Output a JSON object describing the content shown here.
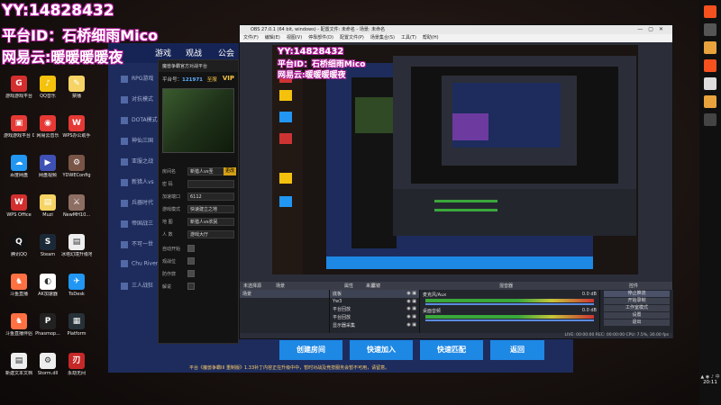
{
  "overlay": {
    "yy": "YY:14828432",
    "platform": "平台ID：石桥细雨Mico",
    "netease": "网易云:暖暖暖暖夜"
  },
  "desktop_icons": [
    {
      "label": "游戏游戏平台",
      "color": "#d32f2f",
      "glyph": "G",
      "icon": "game-platform-icon"
    },
    {
      "label": "QQ音乐",
      "color": "#f4c20d",
      "glyph": "♪",
      "icon": "music-icon"
    },
    {
      "label": "禁播",
      "color": "#f6d365",
      "glyph": "✎",
      "icon": "note-icon"
    },
    {
      "label": "游戏游戏平台 0.7.59",
      "color": "#e53935",
      "glyph": "▣",
      "icon": "file-icon"
    },
    {
      "label": "网易云音乐",
      "color": "#e53935",
      "glyph": "◉",
      "icon": "netease-icon"
    },
    {
      "label": "WPS办公助手",
      "color": "#e53935",
      "glyph": "W",
      "icon": "wps-icon"
    },
    {
      "label": "百度网盘",
      "color": "#2196f3",
      "glyph": "☁",
      "icon": "cloud-icon"
    },
    {
      "label": "网盘视频",
      "color": "#3f51b5",
      "glyph": "▶",
      "icon": "video-icon"
    },
    {
      "label": "YDWEConfig",
      "color": "#795548",
      "glyph": "⚙",
      "icon": "config-icon"
    },
    {
      "label": "WPS Office",
      "color": "#d32f2f",
      "glyph": "W",
      "icon": "wps-office-icon"
    },
    {
      "label": "Muzi",
      "color": "#f6d365",
      "glyph": "▤",
      "icon": "folder-icon"
    },
    {
      "label": "NewMH10...",
      "color": "#8d6e63",
      "glyph": "⚔",
      "icon": "mod-icon"
    },
    {
      "label": "腾讯QQ",
      "color": "#111111",
      "glyph": "Q",
      "icon": "qq-icon"
    },
    {
      "label": "Steam",
      "color": "#1b2838",
      "glyph": "S",
      "icon": "steam-icon"
    },
    {
      "label": "冰塔幻境升级地图脚本",
      "color": "#eeeeee",
      "glyph": "▤",
      "icon": "doc-icon"
    },
    {
      "label": "斗鱼直播",
      "color": "#ff7043",
      "glyph": "♞",
      "icon": "douyu-icon"
    },
    {
      "label": "AK加速器",
      "color": "#ffffff",
      "glyph": "◐",
      "icon": "accel-icon"
    },
    {
      "label": "ToDesk",
      "color": "#2196f3",
      "glyph": "✈",
      "icon": "todesk-icon"
    },
    {
      "label": "斗鱼直播伴侣",
      "color": "#ff7043",
      "glyph": "♞",
      "icon": "douyu-companion-icon"
    },
    {
      "label": "Phasmop...",
      "color": "#222222",
      "glyph": "P",
      "icon": "phasmo-icon"
    },
    {
      "label": "Platform",
      "color": "#263238",
      "glyph": "▦",
      "icon": "platform-icon"
    },
    {
      "label": "新建文本文档",
      "color": "#eeeeee",
      "glyph": "▤",
      "icon": "text-icon"
    },
    {
      "label": "Storm.dll",
      "color": "#eeeeee",
      "glyph": "⚙",
      "icon": "dll-icon"
    },
    {
      "label": "永劫无间",
      "color": "#c62828",
      "glyph": "刃",
      "icon": "naraka-icon"
    }
  ],
  "game": {
    "tabs": [
      "游戏",
      "观战",
      "公会"
    ],
    "side": [
      "RPG游戏",
      "对抗模式",
      "DOTA模式",
      "神仙三国",
      "亚服之战",
      "新猎人vs",
      "兵器时代",
      "帝国战三",
      "不可一世",
      "Chu River",
      "三人战狂"
    ],
    "buttons": [
      "创建房间",
      "快速加入",
      "快速匹配",
      "返回"
    ],
    "notice": "平台《魔兽争霸III 重制版》1.33补丁内容正在升级中中，暂时对战及竞技服务会暂不可用，请留意。"
  },
  "lobby": {
    "title": "魔兽争霸官方对战平台",
    "id_label": "平台号：",
    "id_value": "121971",
    "status": "至服",
    "vip": "VIP",
    "rows": [
      {
        "label": "房间名",
        "value": "新猎人vs圣",
        "tag": "更改"
      },
      {
        "label": "密  码",
        "value": ""
      },
      {
        "label": "加速端口",
        "value": "6112"
      },
      {
        "label": "游戏模式",
        "value": "快速建立之地"
      },
      {
        "label": "地  图",
        "value": "新猎人vs农民"
      },
      {
        "label": "人  数",
        "value": "游戏大厅"
      }
    ],
    "checks": [
      "自动开始",
      "观战位",
      "防作弊",
      "解说"
    ]
  },
  "obs": {
    "title": "OBS 27.0.1 (64 bit, windows) - 配置文件: 未命名 - 场景: 未命名",
    "menu": [
      "文件(F)",
      "编辑(E)",
      "视图(V)",
      "停靠部件(D)",
      "配置文件(P)",
      "场景集合(S)",
      "工具(T)",
      "帮助(H)"
    ],
    "bar": [
      "未选择源",
      "属性",
      "滤镜"
    ],
    "docks": [
      "场景",
      "来源",
      "混音器",
      "控件"
    ],
    "scenes": [
      "场景"
    ],
    "sources": [
      "底板",
      "Yw3",
      "平台回放",
      "平台回放",
      "显示器采集"
    ],
    "mixer": [
      {
        "name": "麦克风/Aux",
        "db": "0.0 dB"
      },
      {
        "name": "桌面音频",
        "db": "0.0 dB"
      }
    ],
    "controls": [
      "停止推流",
      "开始录制",
      "工作室模式",
      "设置",
      "退出"
    ],
    "bottom_tabs": [
      "控件",
      "转场特效"
    ],
    "status": "LIVE: 00:00:00    REC: 00:00:00    CPU: 7.5%, 30.00 fps"
  },
  "taskbar": {
    "time": "20:11",
    "date": "2021/..."
  }
}
